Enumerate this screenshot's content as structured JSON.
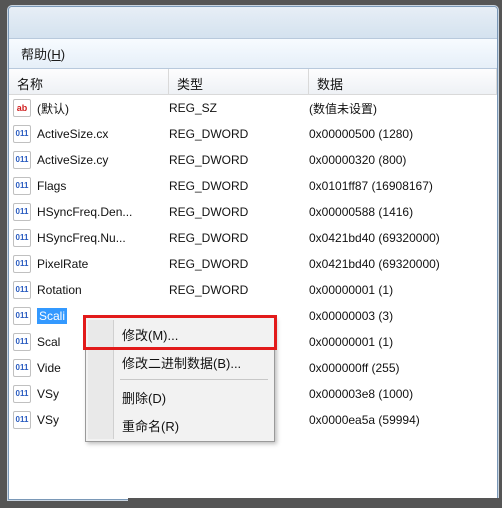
{
  "menubar": {
    "help": "帮助(",
    "help_u": "H",
    "help_end": ")"
  },
  "columns": {
    "name": "名称",
    "type": "类型",
    "data": "数据"
  },
  "rows": [
    {
      "icon": "sz",
      "name": "(默认)",
      "type": "REG_SZ",
      "data": "(数值未设置)"
    },
    {
      "icon": "dw",
      "name": "ActiveSize.cx",
      "type": "REG_DWORD",
      "data": "0x00000500 (1280)"
    },
    {
      "icon": "dw",
      "name": "ActiveSize.cy",
      "type": "REG_DWORD",
      "data": "0x00000320 (800)"
    },
    {
      "icon": "dw",
      "name": "Flags",
      "type": "REG_DWORD",
      "data": "0x0101ff87 (16908167)"
    },
    {
      "icon": "dw",
      "name": "HSyncFreq.Den...",
      "type": "REG_DWORD",
      "data": "0x00000588 (1416)"
    },
    {
      "icon": "dw",
      "name": "HSyncFreq.Nu...",
      "type": "REG_DWORD",
      "data": "0x0421bd40 (69320000)"
    },
    {
      "icon": "dw",
      "name": "PixelRate",
      "type": "REG_DWORD",
      "data": "0x0421bd40 (69320000)"
    },
    {
      "icon": "dw",
      "name": "Rotation",
      "type": "REG_DWORD",
      "data": "0x00000001 (1)"
    },
    {
      "icon": "dw",
      "name": "Scali",
      "type": "",
      "data": "0x00000003 (3)",
      "selected": true
    },
    {
      "icon": "dw",
      "name": "Scal",
      "type": "",
      "data": "0x00000001 (1)"
    },
    {
      "icon": "dw",
      "name": "Vide",
      "type": "",
      "data": "0x000000ff (255)"
    },
    {
      "icon": "dw",
      "name": "VSy",
      "type": "",
      "data": "0x000003e8 (1000)"
    },
    {
      "icon": "dw",
      "name": "VSy",
      "type": "",
      "data": "0x0000ea5a (59994)"
    }
  ],
  "context_menu": {
    "modify": "修改(M)...",
    "modify_binary": "修改二进制数据(B)...",
    "delete": "删除(D)",
    "rename": "重命名(R)"
  },
  "icons": {
    "sz_glyph": "ab",
    "dw_glyph": "011"
  }
}
